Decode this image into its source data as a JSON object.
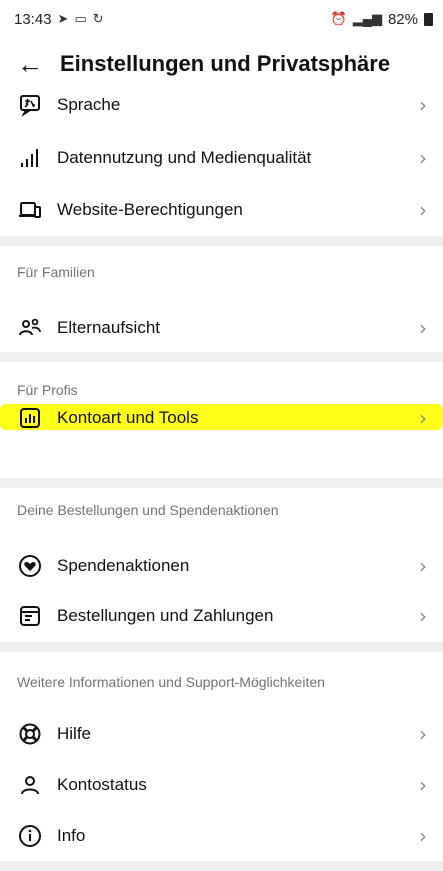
{
  "status": {
    "time": "13:43",
    "battery": "82%"
  },
  "header": {
    "title": "Einstellungen und Privatsphäre"
  },
  "items": {
    "sprache": "Sprache",
    "datennutzung": "Datennutzung und Medienqualität",
    "website": "Website-Berechtigungen",
    "eltern": "Elternaufsicht",
    "kontoart": "Kontoart und Tools",
    "spenden": "Spendenaktionen",
    "bestellungen": "Bestellungen und Zahlungen",
    "hilfe": "Hilfe",
    "kontostatus": "Kontostatus",
    "info": "Info"
  },
  "sections": {
    "familien": "Für Familien",
    "profis": "Für Profis",
    "bestellungen": "Deine Bestellungen und Spendenaktionen",
    "weitere": "Weitere Informationen und Support-Möglichkeiten"
  },
  "icons": {
    "back": "arrow-left-icon",
    "chevron": "chevron-right-icon"
  },
  "colors": {
    "highlight": "#ffff00",
    "divider": "#efefef",
    "section_text": "#737373"
  }
}
